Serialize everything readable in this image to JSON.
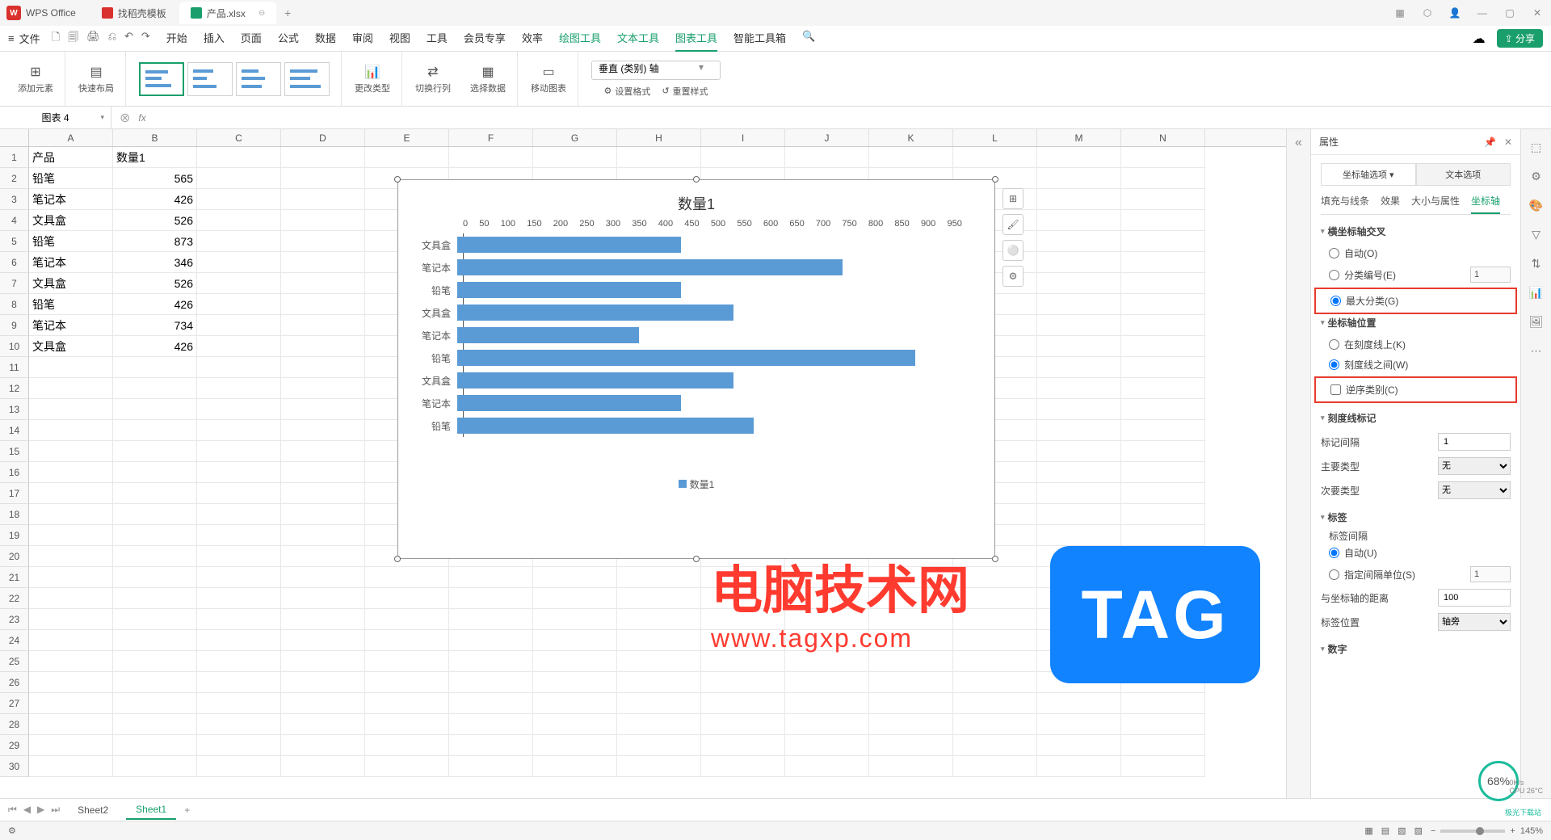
{
  "app": {
    "name": "WPS Office"
  },
  "tabs": [
    {
      "label": "找稻壳模板",
      "color": "#d9312e"
    },
    {
      "label": "产品.xlsx",
      "color": "#1a9f6c",
      "active": true
    }
  ],
  "window_controls": {
    "minimize": "—",
    "maximize": "▢",
    "close": "✕"
  },
  "menu": {
    "file": "文件",
    "hamburger": "≡",
    "qat": [
      "🗋",
      "🗐",
      "🖨",
      "⎌",
      "↶",
      "↷"
    ],
    "items": [
      "开始",
      "插入",
      "页面",
      "公式",
      "数据",
      "审阅",
      "视图",
      "工具",
      "会员专享",
      "效率"
    ],
    "tool_items": [
      "绘图工具",
      "文本工具",
      "图表工具",
      "智能工具箱"
    ],
    "active_tool": "图表工具",
    "search_icon": "🔍",
    "cloud_icon": "☁",
    "share": "分享"
  },
  "ribbon": {
    "add_element": "添加元素",
    "quick_layout": "快速布局",
    "change_type": "更改类型",
    "switch_rowcol": "切换行列",
    "select_data": "选择数据",
    "move_chart": "移动图表",
    "axis_select": "垂直 (类别) 轴",
    "set_format": "设置格式",
    "reset_style": "重置样式"
  },
  "namebox": "图表 4",
  "fx": "fx",
  "columns": [
    "A",
    "B",
    "C",
    "D",
    "E",
    "F",
    "G",
    "H",
    "I",
    "J",
    "K",
    "L",
    "M",
    "N"
  ],
  "rows_count": 30,
  "table": {
    "headers": [
      "产品",
      "数量1"
    ],
    "rows": [
      [
        "铅笔",
        565
      ],
      [
        "笔记本",
        426
      ],
      [
        "文具盒",
        526
      ],
      [
        "铅笔",
        873
      ],
      [
        "笔记本",
        346
      ],
      [
        "文具盒",
        526
      ],
      [
        "铅笔",
        426
      ],
      [
        "笔记本",
        734
      ],
      [
        "文具盒",
        426
      ]
    ]
  },
  "chart_data": {
    "type": "bar",
    "title": "数量1",
    "xlabel": "",
    "ylabel": "",
    "xlim": [
      0,
      950
    ],
    "x_ticks": [
      0,
      50,
      100,
      150,
      200,
      250,
      300,
      350,
      400,
      450,
      500,
      550,
      600,
      650,
      700,
      750,
      800,
      850,
      900,
      950
    ],
    "categories": [
      "文具盒",
      "笔记本",
      "铅笔",
      "文具盒",
      "笔记本",
      "铅笔",
      "文具盒",
      "笔记本",
      "铅笔"
    ],
    "values": [
      426,
      734,
      426,
      526,
      346,
      873,
      526,
      426,
      565
    ],
    "legend": "数量1"
  },
  "chart_side": [
    "⊞",
    "🖌",
    "⚪",
    "⚙"
  ],
  "props": {
    "title": "属性",
    "axis_options": "坐标轴选项",
    "text_options": "文本选项",
    "subtabs": [
      "填充与线条",
      "效果",
      "大小与属性",
      "坐标轴"
    ],
    "active_subtab": "坐标轴",
    "cross_title": "横坐标轴交叉",
    "auto_o": "自动(O)",
    "cat_num_e": "分类编号(E)",
    "cat_num_val": "1",
    "max_cat_g": "最大分类(G)",
    "axis_pos_title": "坐标轴位置",
    "on_tick_k": "在刻度线上(K)",
    "between_w": "刻度线之间(W)",
    "reverse_c": "逆序类别(C)",
    "tickmark_title": "刻度线标记",
    "mark_interval": "标记间隔",
    "mark_interval_val": "1",
    "major_type": "主要类型",
    "minor_type": "次要类型",
    "none": "无",
    "label_title": "标签",
    "label_interval": "标签间隔",
    "auto_u": "自动(U)",
    "spec_unit_s": "指定间隔单位(S)",
    "spec_unit_val": "1",
    "dist_from_axis": "与坐标轴的距离",
    "dist_val": "100",
    "label_pos": "标签位置",
    "label_pos_val": "轴旁",
    "number_title": "数字"
  },
  "sheets": {
    "nav": [
      "⏮",
      "◀",
      "▶",
      "⏭"
    ],
    "items": [
      "Sheet2",
      "Sheet1"
    ],
    "active": "Sheet1",
    "add": "+"
  },
  "status": {
    "left": "⚙",
    "views": [
      "▦",
      "▤",
      "▧",
      "▨"
    ],
    "zoom": "145%"
  },
  "perf": {
    "pct": "68%",
    "disk": "0K/s",
    "cpu": "CPU 26°C"
  },
  "watermark": {
    "text": "电脑技术网",
    "url": "www.tagxp.com",
    "tag": "TAG"
  },
  "download_site": "极光下载站"
}
